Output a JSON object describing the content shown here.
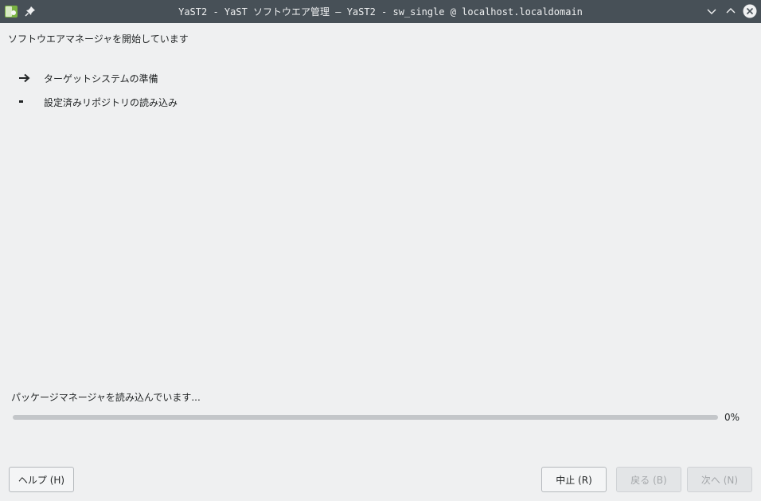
{
  "window": {
    "title": "YaST2 - YaST ソフトウエア管理 — YaST2 - sw_single @ localhost.localdomain",
    "app_icon": "yast-icon",
    "pin_icon": "pin-icon",
    "controls": [
      "minimize-icon",
      "maximize-icon",
      "close-icon"
    ]
  },
  "heading": "ソフトウエアマネージャを開始しています",
  "steps": [
    {
      "label": "ターゲットシステムの準備",
      "state": "current",
      "marker_icon": "arrow-right-icon"
    },
    {
      "label": "設定済みリポジトリの読み込み",
      "state": "pending",
      "marker_icon": "dash-icon"
    }
  ],
  "progress": {
    "label": "パッケージマネージャを読み込んでいます...",
    "value": 0,
    "percent_text": "0%"
  },
  "buttons": {
    "help": "ヘルプ (H)",
    "abort": "中止 (R)",
    "back": "戻る (B)",
    "next": "次へ (N)"
  },
  "colors": {
    "titlebar": "#475057",
    "background": "#eff0f1",
    "progress_accent": "#3daee9"
  }
}
